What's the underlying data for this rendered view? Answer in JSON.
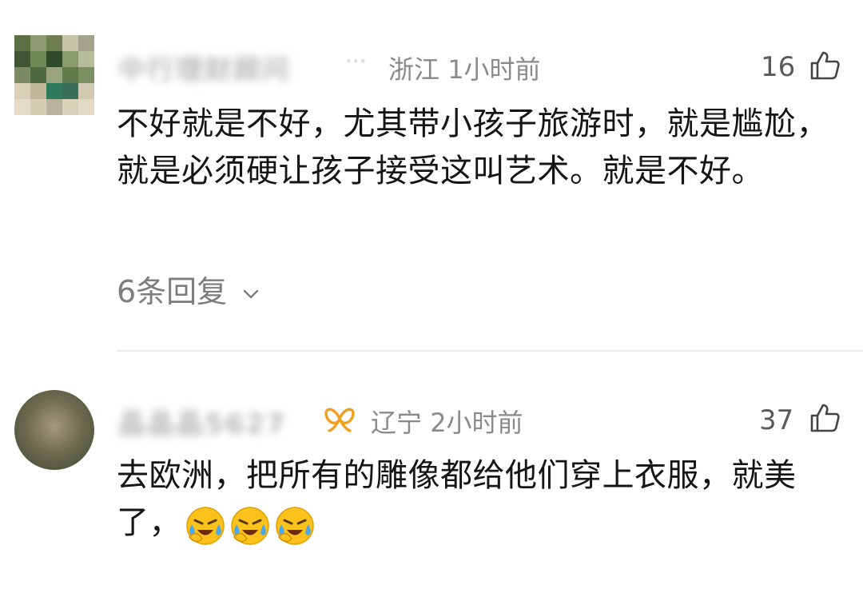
{
  "comments": [
    {
      "username": "中行理财顾问",
      "username_obscured": true,
      "location": "浙江",
      "time": "1小时前",
      "likes": "16",
      "text": "不好就是不好，尤其带小孩子旅游时，就是尴尬，就是必须硬让孩子接受这叫艺术。就是不好。",
      "replies": "6条回复",
      "icons": {
        "like": "thumb-up-icon",
        "replies": "chevron-down-icon"
      }
    },
    {
      "username": "晶晶晶5627",
      "username_obscured": true,
      "location": "辽宁",
      "time": "2小时前",
      "likes": "37",
      "text": "去欧洲，把所有的雕像都给他们穿上衣服，就美了，",
      "emojis": [
        "face-with-tears-emoji",
        "face-with-tears-emoji",
        "face-with-tears-emoji"
      ],
      "badge_icon": "vip-badge-icon",
      "icons": {
        "like": "thumb-up-icon"
      }
    }
  ],
  "colors": {
    "text": "#151515",
    "meta": "#8a8a8a",
    "vip_badge": "#f0a020",
    "divider": "#ececec"
  }
}
